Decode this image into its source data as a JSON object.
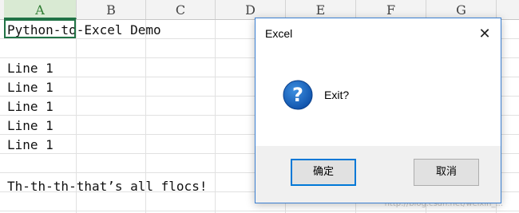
{
  "spreadsheet": {
    "columns": [
      "A",
      "B",
      "C",
      "D",
      "E",
      "F",
      "G"
    ],
    "active_column": "A",
    "cells": {
      "a1": "Python-to-Excel Demo",
      "a3": "Line 1",
      "a4": "Line 1",
      "a5": "Line 1",
      "a6": "Line 1",
      "a7": "Line 1",
      "a9": "Th-th-th-that’s all flocs!"
    }
  },
  "dialog": {
    "title": "Excel",
    "close_glyph": "✕",
    "icon": "question-icon",
    "message": "Exit?",
    "ok_label": "确定",
    "cancel_label": "取消"
  },
  "watermark": "http://blog.csdn.net/weixin_...",
  "colors": {
    "accent": "#217346",
    "dialog_border": "#3b7fd1",
    "icon_blue": "#1565c0",
    "focus_blue": "#0078d7"
  }
}
